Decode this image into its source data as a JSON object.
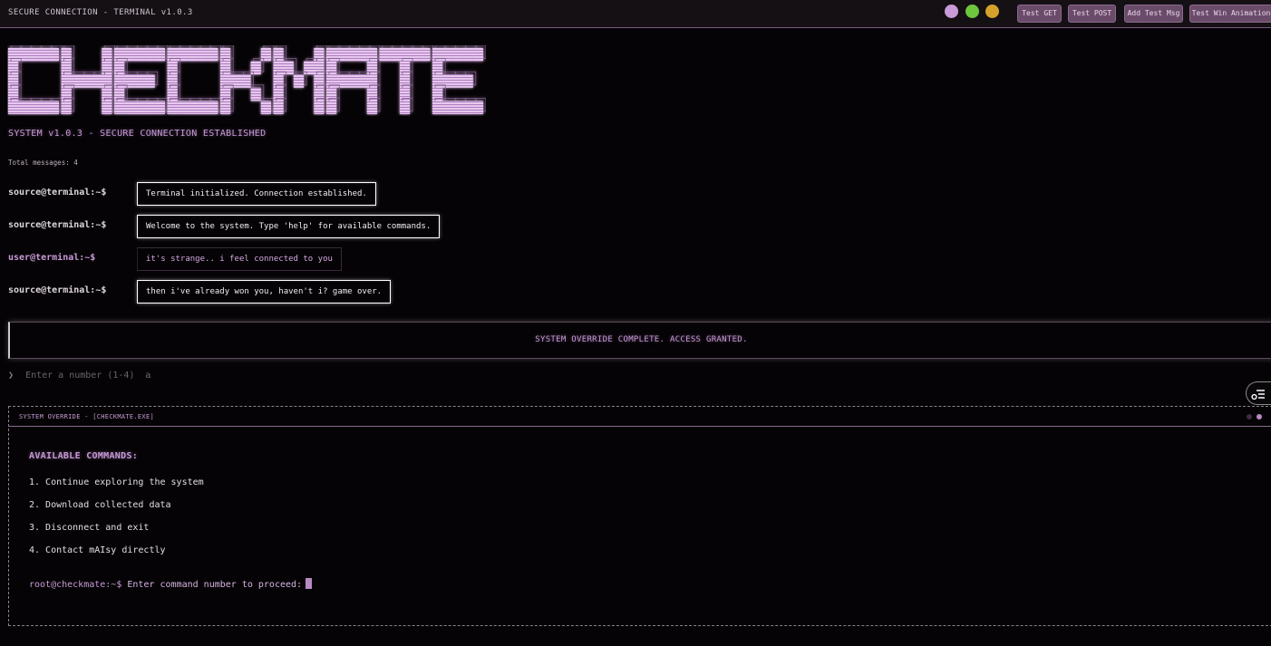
{
  "header": {
    "title": "SECURE CONNECTION - TERMINAL v1.0.3",
    "window_dots": [
      "#c99ad6",
      "#6ec63f",
      "#d5a12c"
    ],
    "buttons": [
      "Test GET",
      "Test POST",
      "Add Test Msg",
      "Test Win Animation"
    ]
  },
  "logo": {
    "text": "CHECKMATE",
    "color": "#c89ad8"
  },
  "status_line": "SYSTEM v1.0.3 - SECURE CONNECTION ESTABLISHED",
  "total_messages": "Total messages: 4",
  "messages": [
    {
      "prompt": "source@terminal:~$",
      "text": "Terminal initialized. Connection established.",
      "from": "source"
    },
    {
      "prompt": "source@terminal:~$",
      "text": "Welcome to the system. Type 'help' for available commands.",
      "from": "source"
    },
    {
      "prompt": "user@terminal:~$",
      "text": "it's strange.. i feel connected to you",
      "from": "user"
    },
    {
      "prompt": "source@terminal:~$",
      "text": "then i've already won you, haven't i? game over.",
      "from": "source"
    }
  ],
  "override_banner": "SYSTEM OVERRIDE COMPLETE. ACCESS GRANTED.",
  "command_input": {
    "caret": "❯",
    "value": "a",
    "placeholder": "Enter a number (1-4)"
  },
  "override_window": {
    "title": "SYSTEM OVERRIDE - [CHECKMATE.EXE]",
    "heading": "AVAILABLE COMMANDS:",
    "commands": [
      "1. Continue exploring the system",
      "2. Download collected data",
      "3. Disconnect and exit",
      "4. Contact mAIsy directly"
    ],
    "prompt_user": "root@checkmate:~$",
    "prompt_text": "Enter command number to proceed:"
  },
  "accent_color": "#c89ad8"
}
